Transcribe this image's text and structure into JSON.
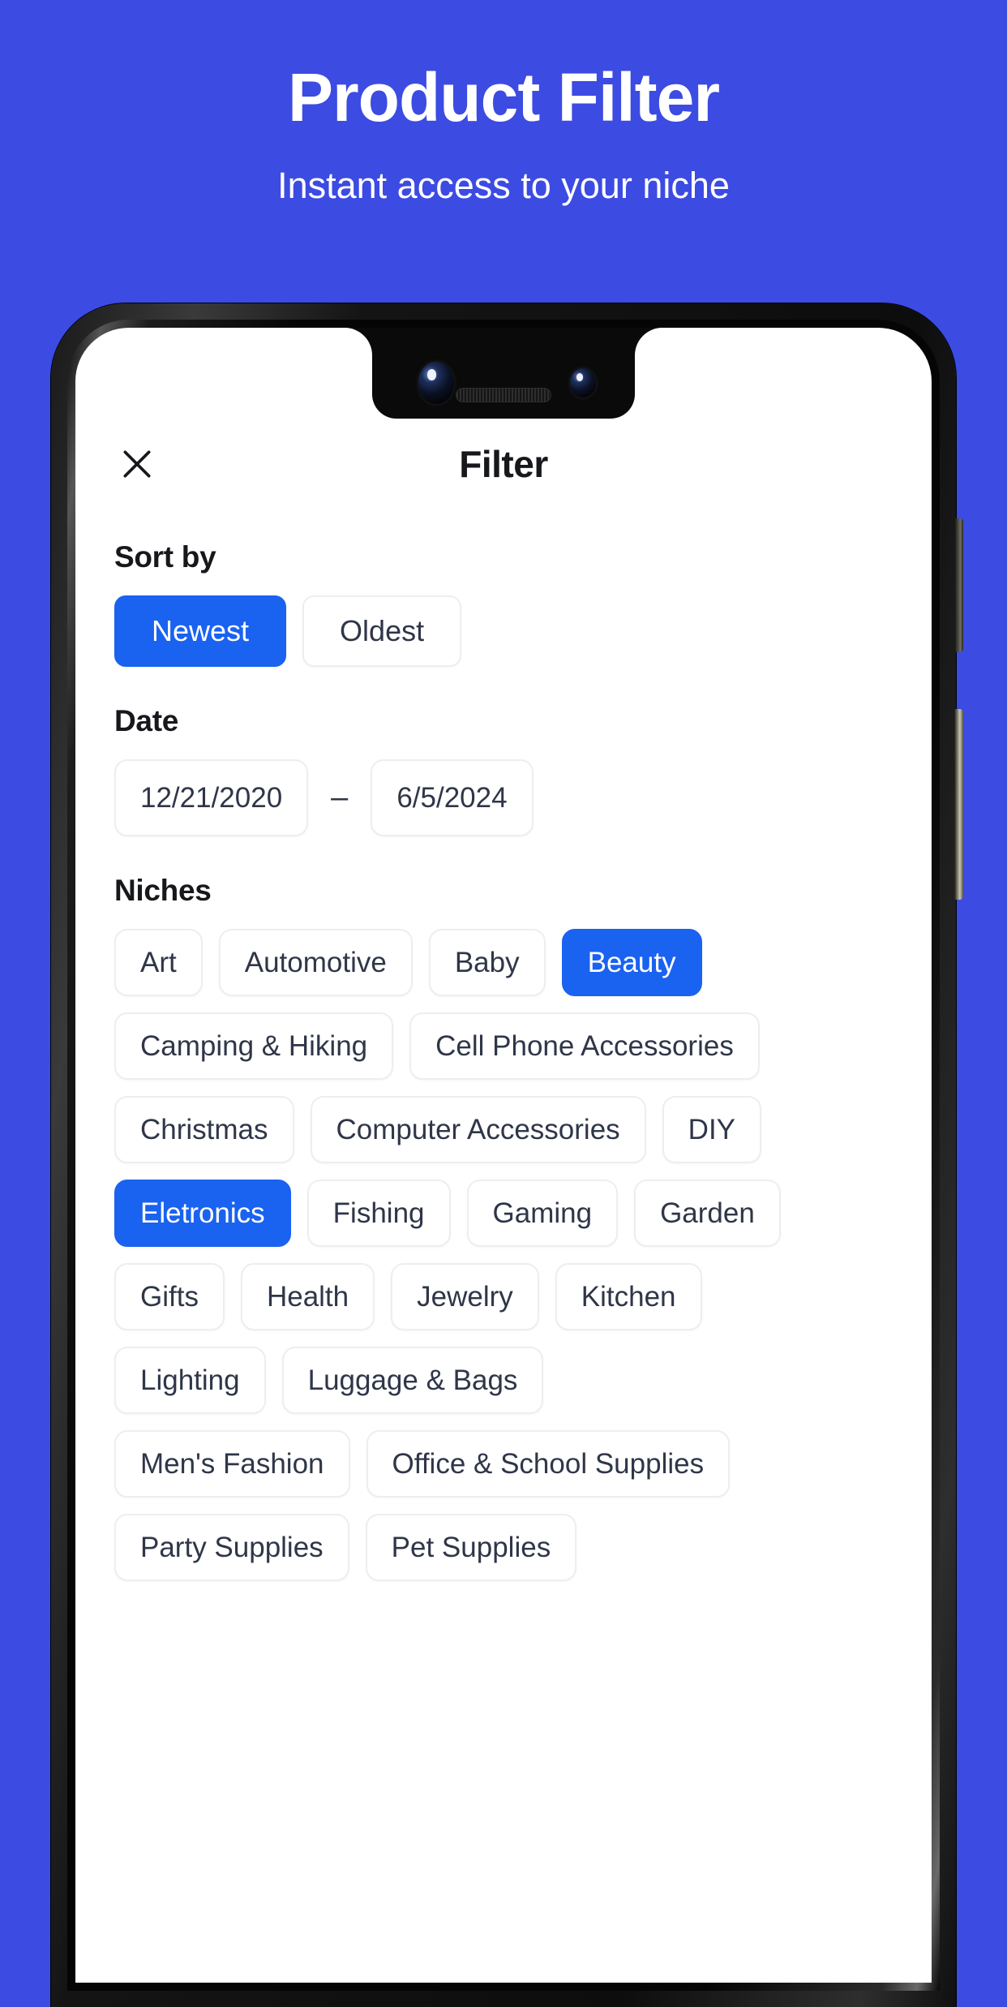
{
  "promo": {
    "title": "Product Filter",
    "subtitle": "Instant access to your niche"
  },
  "colors": {
    "background": "#3C4BE2",
    "accent": "#1A62F0",
    "chip_border": "#ECEEF1",
    "chip_text": "#2F3648",
    "heading": "#17181C"
  },
  "app": {
    "appbar": {
      "close_icon": "close-icon",
      "title": "Filter"
    },
    "sort": {
      "heading": "Sort by",
      "options": [
        {
          "label": "Newest",
          "selected": true
        },
        {
          "label": "Oldest",
          "selected": false
        }
      ]
    },
    "date": {
      "heading": "Date",
      "start": "12/21/2020",
      "separator": "–",
      "end": "6/5/2024"
    },
    "niches": {
      "heading": "Niches",
      "rows": [
        [
          {
            "label": "Art",
            "selected": false
          },
          {
            "label": "Automotive",
            "selected": false
          },
          {
            "label": "Baby",
            "selected": false
          },
          {
            "label": "Beauty",
            "selected": true
          }
        ],
        [
          {
            "label": "Camping & Hiking",
            "selected": false
          },
          {
            "label": "Cell Phone Accessories",
            "selected": false
          }
        ],
        [
          {
            "label": "Christmas",
            "selected": false
          },
          {
            "label": "Computer Accessories",
            "selected": false
          },
          {
            "label": "DIY",
            "selected": false
          }
        ],
        [
          {
            "label": "Eletronics",
            "selected": true
          },
          {
            "label": "Fishing",
            "selected": false
          },
          {
            "label": "Gaming",
            "selected": false
          },
          {
            "label": "Garden",
            "selected": false
          }
        ],
        [
          {
            "label": "Gifts",
            "selected": false
          },
          {
            "label": "Health",
            "selected": false
          },
          {
            "label": "Jewelry",
            "selected": false
          },
          {
            "label": "Kitchen",
            "selected": false
          }
        ],
        [
          {
            "label": "Lighting",
            "selected": false
          },
          {
            "label": "Luggage & Bags",
            "selected": false
          }
        ],
        [
          {
            "label": "Men's Fashion",
            "selected": false
          },
          {
            "label": "Office & School Supplies",
            "selected": false
          }
        ],
        [
          {
            "label": "Party Supplies",
            "selected": false
          },
          {
            "label": "Pet Supplies",
            "selected": false
          }
        ]
      ]
    }
  },
  "device": {
    "front_camera_main": "front-camera-icon",
    "front_camera_secondary": "front-camera-secondary-icon",
    "earpiece": "earpiece-speaker",
    "power_button": "power-button",
    "volume_button": "volume-button"
  }
}
